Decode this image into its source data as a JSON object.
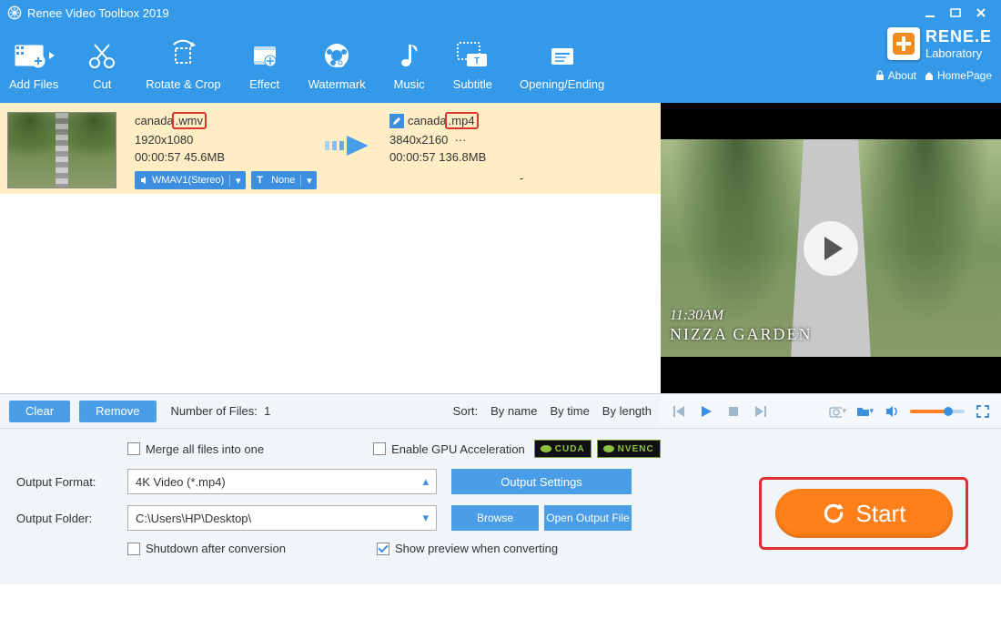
{
  "app": {
    "title": "Renee Video Toolbox 2019",
    "brand1": "RENE.E",
    "brand2": "Laboratory"
  },
  "brandlinks": {
    "about": "About",
    "homepage": "HomePage"
  },
  "toolbar": {
    "addfiles": "Add Files",
    "cut": "Cut",
    "rotate": "Rotate & Crop",
    "effect": "Effect",
    "watermark": "Watermark",
    "music": "Music",
    "subtitle": "Subtitle",
    "opening": "Opening/Ending"
  },
  "file": {
    "src": {
      "name_pre": "canada",
      "name_ext": ".wmv",
      "res": "1920x1080",
      "dur": "00:00:57",
      "size": "45.6MB",
      "audio": "WMAV1(Stereo)",
      "text": "None"
    },
    "dst": {
      "name_pre": "canada",
      "name_ext": ".mp4",
      "res": "3840x2160",
      "res_more": "···",
      "dur": "00:00:57",
      "size": "136.8MB",
      "text": "-"
    }
  },
  "filebar": {
    "clear": "Clear",
    "remove": "Remove",
    "nof_label": "Number of Files:",
    "nof_value": "1",
    "sort_label": "Sort:",
    "by_name": "By name",
    "by_time": "By time",
    "by_length": "By length"
  },
  "preview": {
    "timestamp": "11:30AM",
    "caption": "NIZZA GARDEN"
  },
  "bottom": {
    "merge": "Merge all files into one",
    "gpu": "Enable GPU Acceleration",
    "cuda": "CUDA",
    "nvenc": "NVENC",
    "format_label": "Output Format:",
    "format_value": "4K Video (*.mp4)",
    "folder_label": "Output Folder:",
    "folder_value": "C:\\Users\\HP\\Desktop\\",
    "output_settings": "Output Settings",
    "browse": "Browse",
    "open_output": "Open Output File",
    "shutdown": "Shutdown after conversion",
    "show_preview": "Show preview when converting",
    "start": "Start"
  }
}
